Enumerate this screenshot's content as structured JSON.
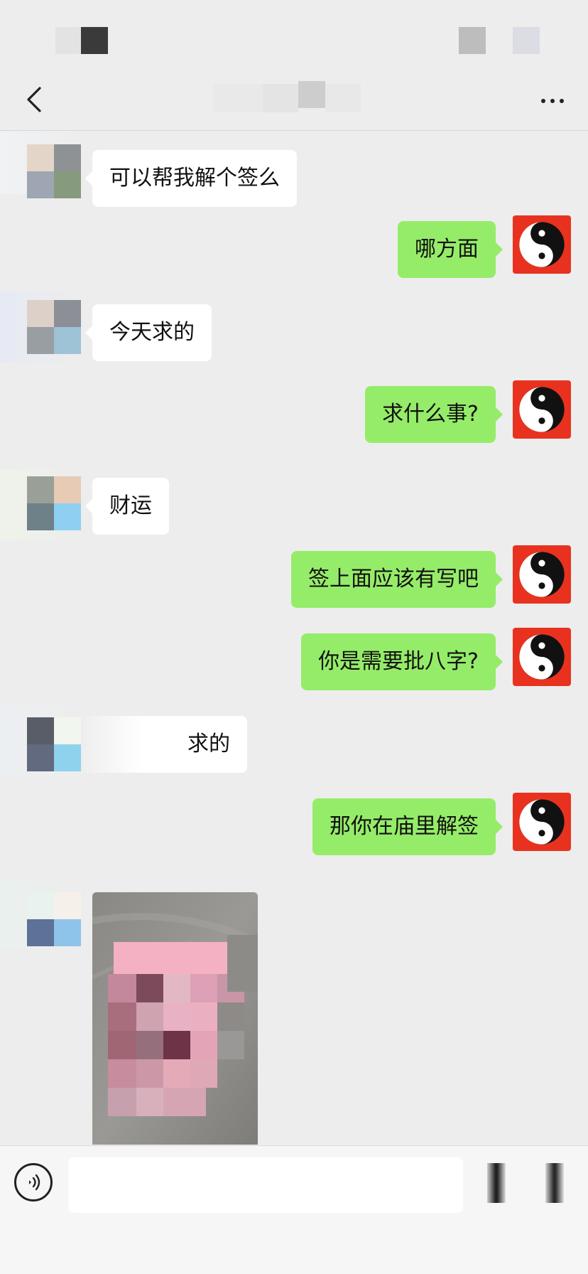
{
  "app": {
    "accent_outgoing": "#95ec69",
    "incoming_bubble": "#ffffff",
    "background": "#ededed"
  },
  "navbar": {
    "title": "",
    "back_icon": "chevron-left-icon",
    "more_icon": "more-icon"
  },
  "messages": [
    {
      "side": "in",
      "text": "可以帮我解个签么"
    },
    {
      "side": "out",
      "text": "哪方面"
    },
    {
      "side": "in",
      "text": "今天求的"
    },
    {
      "side": "out",
      "text": "求什么事?"
    },
    {
      "side": "in",
      "text": "财运"
    },
    {
      "side": "out",
      "text": "签上面应该有写吧"
    },
    {
      "side": "out",
      "text": "你是需要批八字?"
    },
    {
      "side": "in",
      "text": "求的"
    },
    {
      "side": "out",
      "text": "那你在庙里解签"
    },
    {
      "side": "in",
      "type": "image",
      "text": ""
    }
  ],
  "self_avatar": {
    "icon": "yin-yang-icon",
    "color": "#e8321f"
  },
  "input": {
    "voice_icon": "voice-icon",
    "value": "",
    "placeholder": ""
  }
}
